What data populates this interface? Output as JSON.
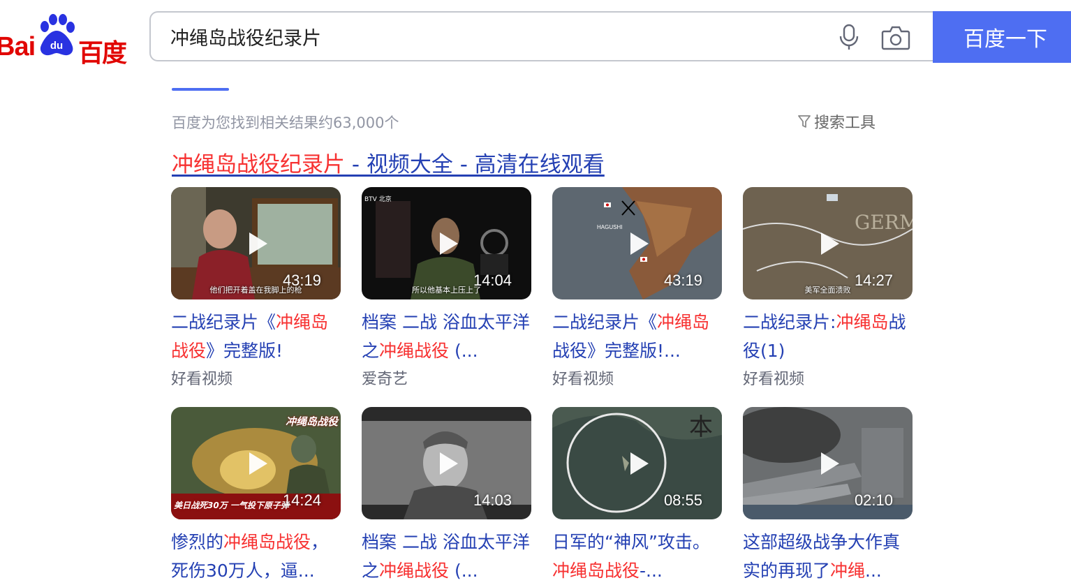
{
  "logo": {
    "latin": "Bai",
    "paw_text": "du",
    "cn": "百度"
  },
  "search": {
    "value": "冲绳岛战役纪录片",
    "button_label": "百度一下"
  },
  "result_count": "百度为您找到相关结果约63,000个",
  "search_tools": "搜索工具",
  "result": {
    "title_highlight": "冲绳岛战役纪录片",
    "title_rest": " - 视频大全 - 高清在线观看"
  },
  "videos": [
    {
      "title_parts": [
        {
          "text": "二战纪录片《",
          "hl": false
        },
        {
          "text": "冲绳岛战役",
          "hl": true
        },
        {
          "text": "》完整版!",
          "hl": false
        }
      ],
      "source": "好看视频",
      "duration": "43:19",
      "caption": "他们把开着盖在我脚上的枪"
    },
    {
      "title_parts": [
        {
          "text": "档案 二战 浴血太平洋之",
          "hl": false
        },
        {
          "text": "冲绳战役",
          "hl": true
        },
        {
          "text": " (...",
          "hl": false
        }
      ],
      "source": "爱奇艺",
      "duration": "14:04",
      "caption": "所以他基本上压上了",
      "badge": "BTV 北京"
    },
    {
      "title_parts": [
        {
          "text": "二战纪录片《",
          "hl": false
        },
        {
          "text": "冲绳岛",
          "hl": true
        },
        {
          "text": "战役》完整版!...",
          "hl": false
        }
      ],
      "source": "好看视频",
      "duration": "43:19",
      "map_label": "HAGUSHI"
    },
    {
      "title_parts": [
        {
          "text": "二战纪录片:",
          "hl": false
        },
        {
          "text": "冲绳岛",
          "hl": true
        },
        {
          "text": "战役(1)",
          "hl": false
        }
      ],
      "source": "好看视频",
      "duration": "14:27",
      "caption": "美军全面溃败",
      "map_label": "GERMANY"
    },
    {
      "title_parts": [
        {
          "text": "惨烈的",
          "hl": false
        },
        {
          "text": "冲绳岛战役",
          "hl": true
        },
        {
          "text": "，死伤30万人，逼...",
          "hl": false
        }
      ],
      "duration": "14:24",
      "overlay_top": "冲绳岛战役",
      "overlay_bottom": "美日战死30万 一气投下原子弹"
    },
    {
      "title_parts": [
        {
          "text": "档案 二战 浴血太平洋之",
          "hl": false
        },
        {
          "text": "冲绳战役",
          "hl": true
        },
        {
          "text": " (...",
          "hl": false
        }
      ],
      "duration": "14:03"
    },
    {
      "title_parts": [
        {
          "text": "日军的“神风”攻击。",
          "hl": false
        },
        {
          "text": "冲绳岛战役",
          "hl": true
        },
        {
          "text": "-...",
          "hl": false
        }
      ],
      "duration": "08:55",
      "map_label": "本"
    },
    {
      "title_parts": [
        {
          "text": "这部超级战争大作真实的再现了",
          "hl": false
        },
        {
          "text": "冲绳",
          "hl": true
        },
        {
          "text": "...",
          "hl": false
        }
      ],
      "duration": "02:10"
    }
  ],
  "colors": {
    "brand_blue": "#4e6ef2",
    "link_blue": "#2440b3",
    "highlight_red": "#f73131",
    "logo_red": "#e10602",
    "muted_gray": "#9195a3"
  }
}
